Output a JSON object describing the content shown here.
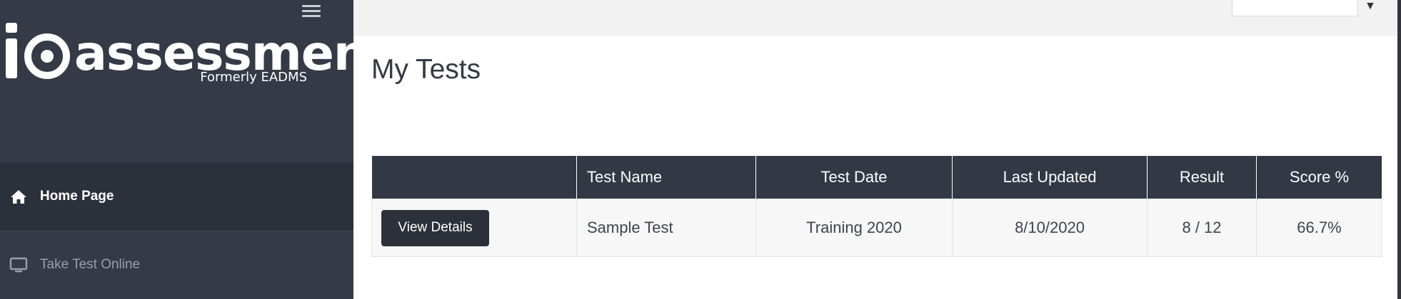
{
  "sidebar": {
    "logo_text": "assessment",
    "logo_mark": "io",
    "logo_subtitle": "Formerly EADMS",
    "menu_icon": "hamburger-menu-icon",
    "items": [
      {
        "label": "Home Page",
        "icon": "home-icon",
        "active": true
      },
      {
        "label": "Take Test Online",
        "icon": "monitor-icon",
        "active": false
      }
    ]
  },
  "topbar": {
    "select_value": "",
    "caret_icon": "caret-down-icon"
  },
  "main": {
    "title": "My Tests",
    "table": {
      "headers": [
        "",
        "Test Name",
        "Test Date",
        "Last Updated",
        "Result",
        "Score %"
      ],
      "rows": [
        {
          "action_label": "View Details",
          "test_name": "Sample Test",
          "test_date": "Training 2020",
          "last_updated": "8/10/2020",
          "result": "8 / 12",
          "score": "66.7%"
        }
      ]
    }
  },
  "colors": {
    "sidebar_bg": "#343a46",
    "header_bg": "#323844",
    "button_bg": "#2b303b"
  }
}
